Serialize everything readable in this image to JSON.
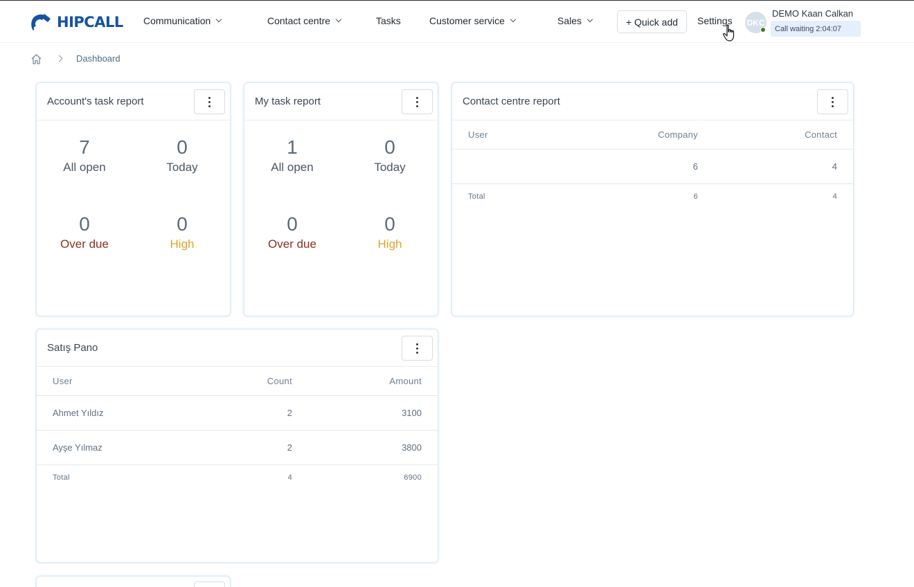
{
  "header": {
    "logo_text": "HIPCALL",
    "nav": [
      {
        "label": "Communication"
      },
      {
        "label": "Contact centre"
      },
      {
        "label": "Tasks"
      },
      {
        "label": "Customer service"
      },
      {
        "label": "Sales"
      }
    ],
    "quick_add_label": "+ Quick add",
    "settings_label": "Settings",
    "avatar_initials": "DKC",
    "user_name": "DEMO Kaan Calkan",
    "call_status": "Call waiting 2:04:07"
  },
  "breadcrumb": {
    "current": "Dashboard"
  },
  "account_task_report": {
    "title": "Account's task report",
    "all_open": {
      "value": "7",
      "label": "All open"
    },
    "today": {
      "value": "0",
      "label": "Today"
    },
    "over_due": {
      "value": "0",
      "label": "Over due"
    },
    "high": {
      "value": "0",
      "label": "High"
    }
  },
  "my_task_report": {
    "title": "My task report",
    "all_open": {
      "value": "1",
      "label": "All open"
    },
    "today": {
      "value": "0",
      "label": "Today"
    },
    "over_due": {
      "value": "0",
      "label": "Over due"
    },
    "high": {
      "value": "0",
      "label": "High"
    }
  },
  "contact_centre_report": {
    "title": "Contact centre report",
    "columns": [
      "User",
      "Company",
      "Contact"
    ],
    "rows": [
      {
        "user": "",
        "company": "6",
        "contact": "4"
      }
    ],
    "total": {
      "label": "Total",
      "company": "6",
      "contact": "4"
    }
  },
  "satis_pano": {
    "title": "Satış Pano",
    "columns": [
      "User",
      "Count",
      "Amount"
    ],
    "rows": [
      {
        "user": "Ahmet Yıldız",
        "count": "2",
        "amount": "3100"
      },
      {
        "user": "Ayşe Yılmaz",
        "count": "2",
        "amount": "3800"
      }
    ],
    "total": {
      "label": "Total",
      "count": "4",
      "amount": "6900"
    }
  },
  "colors": {
    "brand": "#1553a3",
    "over_due": "#8b2e1c",
    "high": "#e0a22a",
    "online": "#3e7a2a"
  }
}
